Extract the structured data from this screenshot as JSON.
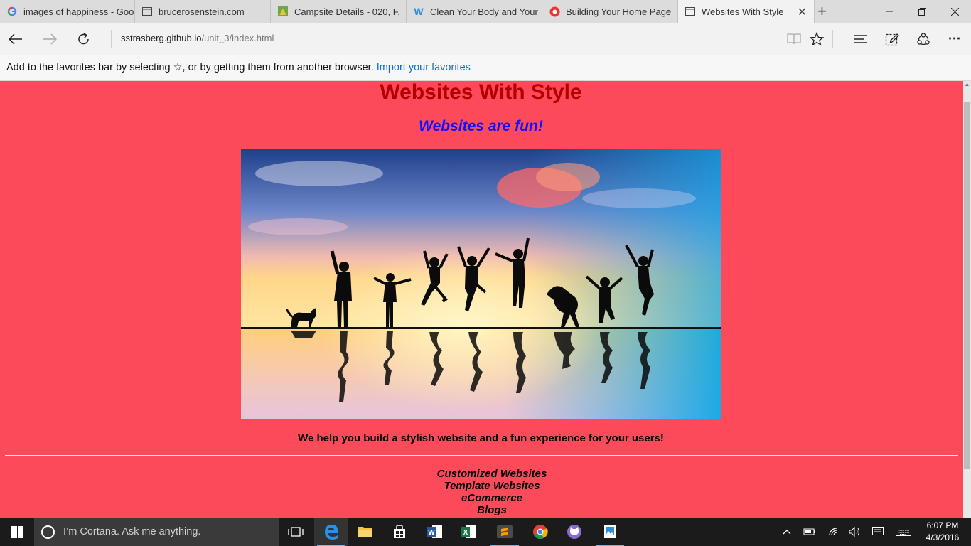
{
  "tabs": [
    {
      "title": "images of happiness - Goo",
      "icon": "google-icon"
    },
    {
      "title": "brucerosenstein.com",
      "icon": "page-icon"
    },
    {
      "title": "Campsite Details - 020, F.",
      "icon": "map-icon"
    },
    {
      "title": "Clean Your Body and Your",
      "icon": "weebly-icon"
    },
    {
      "title": "Building Your Home Page",
      "icon": "red-circle-icon"
    },
    {
      "title": "Websites With Style",
      "icon": "page-icon"
    }
  ],
  "address": {
    "host": "sstrasberg.github.io",
    "path": "/unit_3/index.html"
  },
  "favorites_bar": {
    "message": "Add to the favorites bar by selecting ☆, or by getting them from another browser.",
    "link": "Import your favorites"
  },
  "page": {
    "title": "Websites With Style",
    "subtitle": "Websites are fun!",
    "tagline": "We help you build a stylish website and a fun experience for your users!",
    "services": [
      "Customized Websites",
      "Template Websites",
      "eCommerce",
      "Blogs"
    ]
  },
  "taskbar": {
    "search_placeholder": "I’m Cortana. Ask me anything.",
    "time": "6:07 PM",
    "date": "4/3/2016"
  },
  "colors": {
    "page_background": "#fd4a5b",
    "title": "#b30000",
    "subtitle": "#1010ff",
    "link": "#0a6fd0"
  }
}
